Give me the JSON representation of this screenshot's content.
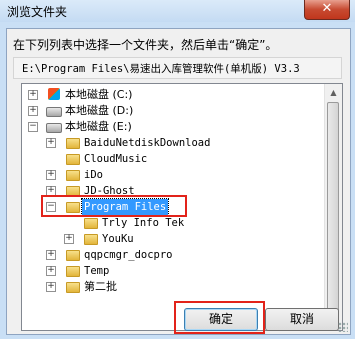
{
  "window": {
    "title": "浏览文件夹",
    "close_glyph": "✕"
  },
  "instruction": "在下列列表中选择一个文件夹，然后单击“确定”。",
  "current_path": "E:\\Program Files\\易速出入库管理软件(单机版) V3.3",
  "tree": {
    "drive_c": "本地磁盘 (C:)",
    "drive_d": "本地磁盘 (D:)",
    "drive_e": "本地磁盘 (E:)",
    "items": {
      "baidu": "BaiduNetdiskDownload",
      "cloudmusic": "CloudMusic",
      "ido": "iDo",
      "jdghost": "JD-Ghost",
      "programfiles": "Program Files",
      "trlyinfotek": "Trly Info Tek",
      "youku": "YouKu",
      "qqpcmgr": "qqpcmgr_docpro",
      "temp": "Temp",
      "dierpi": "第二批"
    },
    "expand_glyph": "+",
    "collapse_glyph": "−"
  },
  "buttons": {
    "ok": "确定",
    "cancel": "取消"
  },
  "colors": {
    "highlight": "#e2231a",
    "selection": "#3399ff"
  }
}
